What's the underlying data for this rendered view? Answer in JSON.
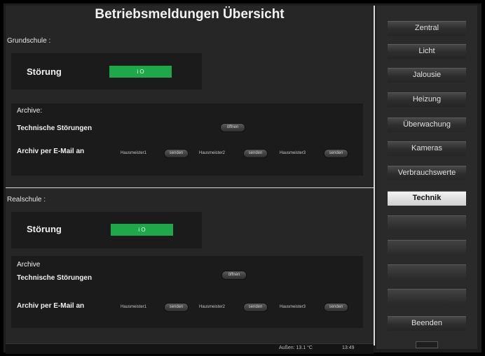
{
  "page_title": "Betriebsmeldungen Übersicht",
  "sections": [
    {
      "name": "Grundschule :",
      "stoerung_label": "Störung",
      "status": "i O",
      "archive_label": "Archive:",
      "tech_label": "Technische Störungen",
      "open_button": "öffnen",
      "email_label": "Archiv per E-Mail an",
      "recipients": [
        {
          "name": "Hausmeister1",
          "button": "senden"
        },
        {
          "name": "Hausmeister2",
          "button": "senden"
        },
        {
          "name": "Hausmeister3",
          "button": "senden"
        }
      ]
    },
    {
      "name": "Realschule :",
      "stoerung_label": "Störung",
      "status": "i O",
      "archive_label": "Archive",
      "tech_label": "Technische Störungen",
      "open_button": "öffnen",
      "email_label": "Archiv per E-Mail an",
      "recipients": [
        {
          "name": "Hausmeister1",
          "button": "senden"
        },
        {
          "name": "Hausmeister2",
          "button": "senden"
        },
        {
          "name": "Hausmeister3",
          "button": "senden"
        }
      ]
    }
  ],
  "status_bar": {
    "outside_temp": "Außen: 13.1 °C",
    "time": "13:49"
  },
  "nav": {
    "items": [
      "Zentral",
      "Licht",
      "Jalousie",
      "Heizung",
      "Überwachung",
      "Kameras",
      "Verbrauchswerte",
      "Technik",
      "",
      "",
      "",
      "",
      "Beenden"
    ],
    "active": "Technik"
  },
  "colors": {
    "status_ok": "#1fa84a",
    "active_nav": "#e6e6e6"
  }
}
